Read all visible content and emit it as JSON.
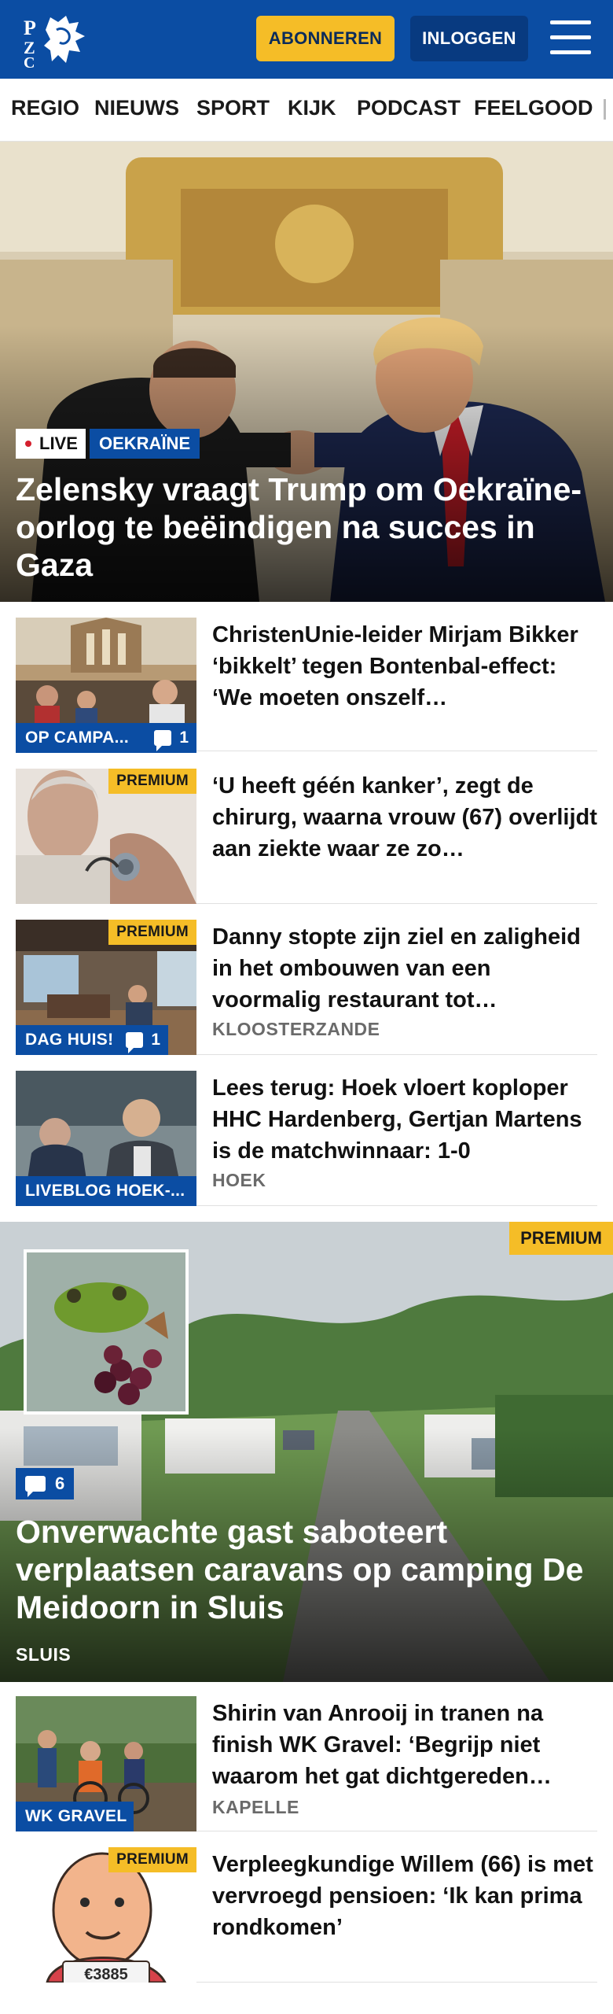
{
  "brand": {
    "logo_text": "PZC",
    "accent": "#0b4da3",
    "premium_color": "#f5bd27"
  },
  "header": {
    "subscribe_label": "ABONNEREN",
    "login_label": "INLOGGEN",
    "menu_icon": "hamburger-icon"
  },
  "nav": {
    "items": [
      "REGIO",
      "NIEUWS",
      "SPORT",
      "KIJK",
      "PODCAST",
      "FEELGOOD"
    ]
  },
  "hero": {
    "live_label": "LIVE",
    "section_label": "OEKRAÏNE",
    "title": "Zelensky vraagt Trump om Oekraïne-oorlog te beëindigen na succes in Gaza"
  },
  "articles": [
    {
      "title": "ChristenUnie-leider Mirjam Bikker ‘bikkelt’ tegen Bontenbal-effect: ‘We moeten onszelf…",
      "category": "OP CAMPA...",
      "comments": "1"
    },
    {
      "title": "‘U heeft géén kanker’, zegt de chirurg, waarna vrouw (67) overlijdt aan ziekte waar ze zo…",
      "premium": "PREMIUM"
    },
    {
      "title": "Danny stopte zijn ziel en zaligheid in het ombouwen van een voormalig restaurant tot…",
      "premium": "PREMIUM",
      "category": "DAG HUIS!",
      "comments": "1",
      "location": "KLOOSTERZANDE"
    },
    {
      "title": "Lees terug: Hoek vloert koploper HHC Hardenberg, Gertjan Martens is de matchwinnaar: 1-0",
      "category": "LIVEBLOG HOEK-...",
      "location": "HOEK"
    }
  ],
  "feature": {
    "premium": "PREMIUM",
    "comments": "6",
    "title": "Onverwachte gast saboteert verplaatsen caravans op camping De Meidoorn in Sluis",
    "location": "SLUIS"
  },
  "articles_more": [
    {
      "title": "Shirin van Anrooij in tranen na finish WK Gravel: ‘Begrijp niet waarom het gat dichtgereden…",
      "category": "WK GRAVEL",
      "location": "KAPELLE"
    },
    {
      "title": "Verpleegkundige Willem (66) is met vervroegd pensioen: ‘Ik kan prima rondkomen’",
      "premium": "PREMIUM",
      "sign_text": "€3885"
    }
  ]
}
